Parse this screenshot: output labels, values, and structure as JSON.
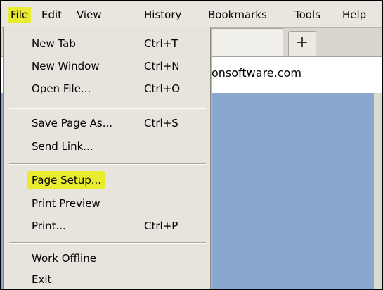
{
  "menubar": {
    "items": [
      "File",
      "Edit",
      "View",
      "History",
      "Bookmarks",
      "Tools",
      "Help"
    ]
  },
  "tabs": {
    "newtab_symbol": "+"
  },
  "urlbar": {
    "text": "onsoftware.com"
  },
  "file_menu": {
    "items": [
      {
        "label": "New Tab",
        "shortcut": "Ctrl+T"
      },
      {
        "label": "New Window",
        "shortcut": "Ctrl+N"
      },
      {
        "label": "Open File...",
        "shortcut": "Ctrl+O"
      },
      {
        "label": "Save Page As...",
        "shortcut": "Ctrl+S"
      },
      {
        "label": "Send Link...",
        "shortcut": ""
      },
      {
        "label": "Page Setup...",
        "shortcut": ""
      },
      {
        "label": "Print Preview",
        "shortcut": ""
      },
      {
        "label": "Print...",
        "shortcut": "Ctrl+P"
      },
      {
        "label": "Work Offline",
        "shortcut": ""
      },
      {
        "label": "Exit",
        "shortcut": ""
      }
    ]
  },
  "colors": {
    "highlight": "#e9ec2e",
    "content_bg": "#8aa7cf",
    "menu_bg": "#e7e4dd"
  }
}
